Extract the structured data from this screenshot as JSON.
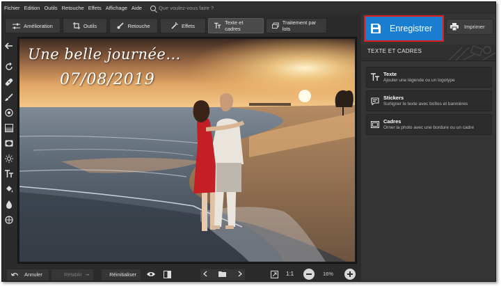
{
  "menu": {
    "items": [
      "Fichier",
      "Edition",
      "Outils",
      "Retouche",
      "Effets",
      "Affichage",
      "Aide"
    ],
    "search_placeholder": "Que voulez-vous faire ?"
  },
  "toolbar": {
    "amelioration": "Amélioration",
    "outils": "Outils",
    "retouche": "Retouche",
    "effets": "Effets",
    "texte": "Texte et cadres",
    "lots": "Traitement par lots",
    "active": "Texte et cadres"
  },
  "canvas": {
    "title_text": "Une belle journée...",
    "date_text": "07/08/2019"
  },
  "bottom": {
    "undo": "Annuler",
    "redo": "Rétablir",
    "reset": "Réinitialiser",
    "ratio": "1:1",
    "zoom": "16%"
  },
  "right": {
    "save": "Enregistrer",
    "print": "Imprimer",
    "panel_title": "TEXTE ET CADRES",
    "options": [
      {
        "title": "Texte",
        "desc": "Ajouter une légende ou un logotype"
      },
      {
        "title": "Stickers",
        "desc": "Surligner le texte avec boîtes et bannières"
      },
      {
        "title": "Cadres",
        "desc": "Orner la photo avec une bordure ou un cadre"
      }
    ]
  },
  "colors": {
    "save_blue": "#1a7fd1",
    "highlight_red": "#e01b1b",
    "panel_bg": "#353535",
    "app_bg": "#2b2b2b"
  },
  "icons": {
    "left_tools": [
      "back-arrow-icon",
      "rotate-icon",
      "bandage-icon",
      "brush-icon",
      "radial-icon",
      "gradient-icon",
      "vignette-icon",
      "sun-icon",
      "text-icon",
      "fill-icon",
      "color-drop-icon",
      "target-icon"
    ]
  }
}
